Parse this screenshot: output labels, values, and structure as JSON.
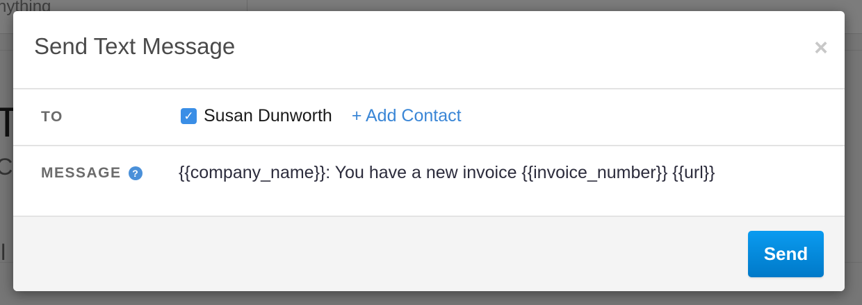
{
  "background": {
    "search_fragment": "nything",
    "heading_fragment": "T",
    "sub_fragment": "C",
    "text_fragment": "ll"
  },
  "modal": {
    "title": "Send Text Message",
    "close_icon": "×",
    "to_label": "TO",
    "contact_name": "Susan Dunworth",
    "contact_checked": true,
    "add_contact_label": "+ Add Contact",
    "message_label": "MESSAGE",
    "help_icon": "?",
    "message_text": "{{company_name}}: You have a new invoice {{invoice_number}} {{url}}",
    "send_label": "Send"
  },
  "colors": {
    "accent": "#3a8ee6",
    "send_button": "#0a8fe0"
  }
}
